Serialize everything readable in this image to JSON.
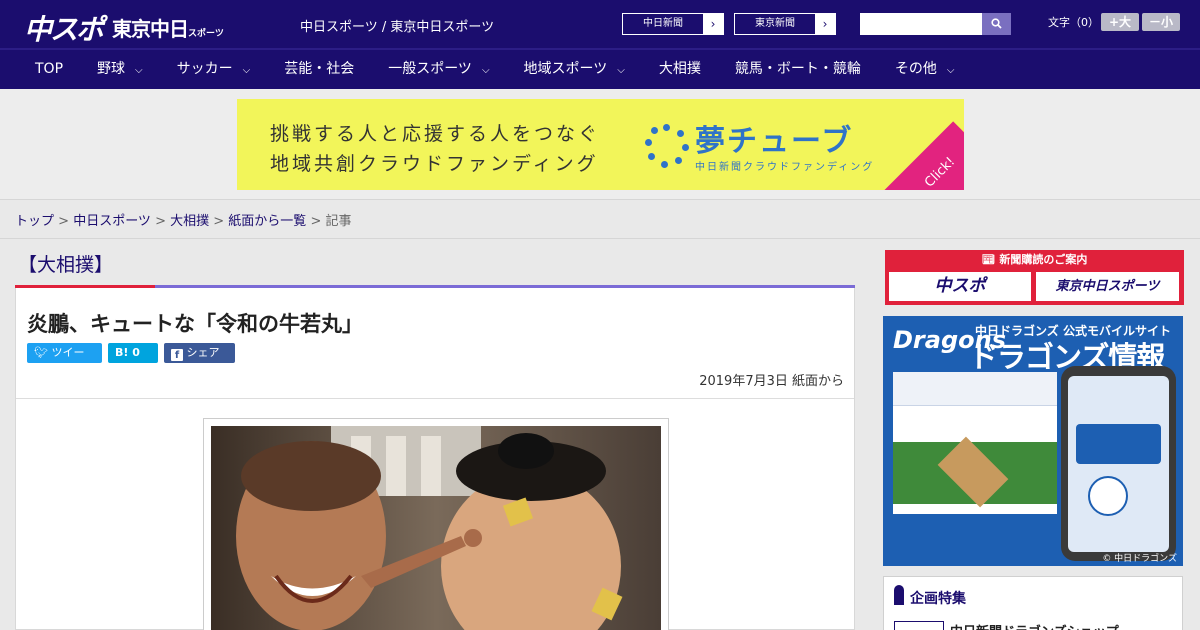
{
  "header": {
    "logo_chunichi_sports": "中スポ",
    "logo_tokyo_chunichi": "東京中日",
    "logo_tokyo_chunichi_small": "スポーツ",
    "tagline": "中日スポーツ / 東京中日スポーツ",
    "link_chunichi_shimbun": "中日新聞",
    "link_tokyo_shimbun": "東京新聞",
    "search_placeholder": "",
    "font_size_label": "文字（0）",
    "font_larger": "+大",
    "font_smaller": "－小"
  },
  "nav": [
    {
      "label": "TOP",
      "dropdown": false
    },
    {
      "label": "野球",
      "dropdown": true
    },
    {
      "label": "サッカー",
      "dropdown": true
    },
    {
      "label": "芸能・社会",
      "dropdown": false
    },
    {
      "label": "一般スポーツ",
      "dropdown": true
    },
    {
      "label": "地域スポーツ",
      "dropdown": true
    },
    {
      "label": "大相撲",
      "dropdown": false
    },
    {
      "label": "競馬・ボート・競輪",
      "dropdown": false
    },
    {
      "label": "その他",
      "dropdown": true
    }
  ],
  "ad": {
    "line1": "挑戦する人と応援する人をつなぐ",
    "line2": "地域共創クラウドファンディング",
    "brand": "夢チューブ",
    "brand_sub": "中日新聞クラウドファンディング",
    "click": "Click!"
  },
  "breadcrumb": {
    "items": [
      "トップ",
      "中日スポーツ",
      "大相撲",
      "紙面から一覧"
    ],
    "current": "記事",
    "separator": " > "
  },
  "article": {
    "category": "【大相撲】",
    "title": "炎鵬、キュートな「令和の牛若丸」",
    "share_twitter": "ツイート",
    "share_hatena": "B! 0",
    "share_facebook": "シェア 0",
    "date": "2019年7月3日 紙面から"
  },
  "sidebar": {
    "subscribe_header": "新聞購読のご案内",
    "subscribe_btn1": "中スポ",
    "subscribe_btn2": "東京中日スポーツ",
    "dragons_logo": "Dragons",
    "dragons_t1": "中日ドラゴンズ 公式モバイルサイト",
    "dragons_t2": "ドラゴンズ情報",
    "dragons_copy": "© 中日ドラゴンズ",
    "feature_header": "企画特集",
    "feature_item": "中日新聞ドラゴンズショップ"
  },
  "colors": {
    "navy": "#1b0d6e",
    "red": "#e0213b",
    "purple": "#7b6bd6",
    "twitter": "#1da1f2",
    "hatena": "#00a4de",
    "facebook": "#3b5998"
  }
}
